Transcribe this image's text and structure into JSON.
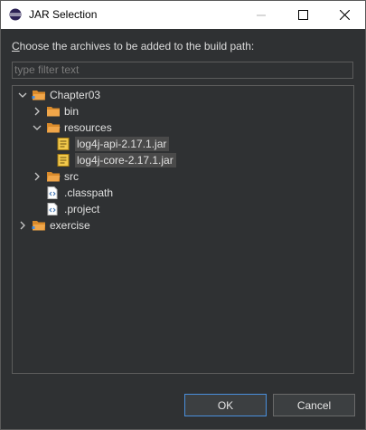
{
  "window": {
    "title": "JAR Selection"
  },
  "dialog": {
    "prompt_mnemonic": "C",
    "prompt_rest": "hoose the archives to be added to the build path:",
    "filter": {
      "placeholder": "type filter text",
      "value": ""
    }
  },
  "tree": {
    "project": "Chapter03",
    "bin": "bin",
    "resources": "resources",
    "jar1": "log4j-api-2.17.1.jar",
    "jar2": "log4j-core-2.17.1.jar",
    "src": "src",
    "classpath": ".classpath",
    "projectfile": ".project",
    "exercise": "exercise"
  },
  "buttons": {
    "ok": "OK",
    "cancel": "Cancel"
  }
}
